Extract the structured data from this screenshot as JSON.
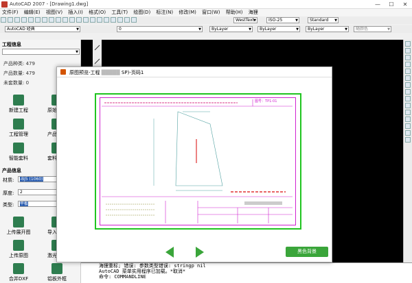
{
  "app": {
    "title": "AutoCAD 2007 - [Drawing1.dwg]",
    "window_controls": [
      "—",
      "☐",
      "✕"
    ],
    "menus": [
      "文件(F)",
      "编辑(E)",
      "视图(V)",
      "插入(I)",
      "格式(O)",
      "工具(T)",
      "绘图(D)",
      "标注(N)",
      "修改(M)",
      "窗口(W)",
      "帮助(H)",
      "海狸"
    ]
  },
  "toolbars": {
    "workspace": "AutoCAD 经典",
    "layer": "0",
    "text_style": "WestText",
    "dim_style": "ISO-25",
    "table_style": "Standard",
    "color": "ByLayer",
    "linetype": "ByLayer",
    "lineweight": "ByLayer",
    "plot_style": "随颜色"
  },
  "left_panel": {
    "project_info_title": "工程信息",
    "project_selector": "",
    "stats": [
      {
        "label": "产品种类:",
        "value": "479"
      },
      {
        "label": "产品数量:",
        "value": "479"
      },
      {
        "label": "未套数量:",
        "value": "0"
      }
    ],
    "tools_top": [
      {
        "label": "新建工程",
        "icon": "new-project-icon"
      },
      {
        "label": "原始图纸",
        "icon": "original-drawing-icon"
      },
      {
        "label": "工程管理",
        "icon": "project-manage-icon"
      },
      {
        "label": "产品管理",
        "icon": "product-manage-icon"
      },
      {
        "label": "智能套料",
        "icon": "smart-nesting-icon"
      },
      {
        "label": "套料订单",
        "icon": "nesting-order-icon"
      }
    ],
    "product_info_title": "产品信息",
    "material_label": "材质:",
    "material_value": "-BJ5 (1060)",
    "thickness_label": "厚度:",
    "thickness_value": "2",
    "type_label": "类型:",
    "type_value": "平板",
    "tools_bottom": [
      {
        "label": "上传展开图",
        "icon": "upload-unfold-icon"
      },
      {
        "label": "导入产品",
        "icon": "import-product-icon"
      },
      {
        "label": "上传原图",
        "icon": "upload-original-icon"
      },
      {
        "label": "激光打码",
        "icon": "laser-mark-icon"
      },
      {
        "label": "合并DXF",
        "icon": "merge-dxf-icon"
      },
      {
        "label": "铝板外框",
        "icon": "aluminum-frame-icon"
      }
    ]
  },
  "dialog": {
    "title": "原图预览-工程",
    "title_suffix": "SP)-页码1",
    "drawing_no_label": "图号：",
    "drawing_no": "TP1-01",
    "confirm_button": "黑色背景"
  },
  "command_line": {
    "lines": [
      "海狸重标; 错误: 参数类型错误: stringp nil",
      "AutoCAD 菜单实用程序已加载。*取消*",
      "命令: COMMANDLINE"
    ]
  },
  "colors": {
    "frame_green": "#1fc41f",
    "frame_magenta": "#d020d0",
    "accent_green": "#3aa53a",
    "selection_blue": "#2a5db0"
  }
}
